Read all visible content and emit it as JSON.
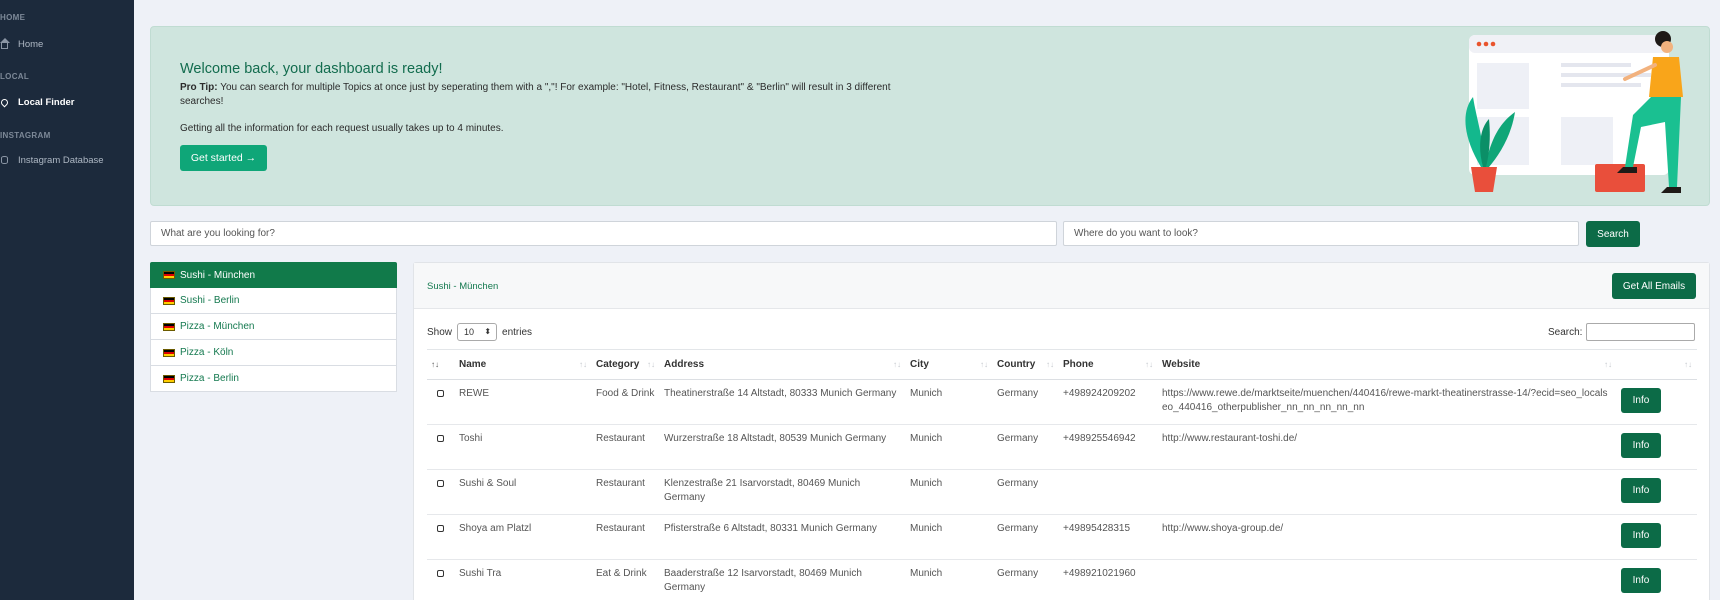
{
  "sidebar": {
    "sections": [
      {
        "heading": "HOME",
        "items": [
          {
            "label": "Home",
            "icon": "home-icon"
          }
        ]
      },
      {
        "heading": "LOCAL",
        "items": [
          {
            "label": "Local Finder",
            "icon": "map-pin-icon"
          }
        ]
      },
      {
        "heading": "INSTAGRAM",
        "items": [
          {
            "label": "Instagram Database",
            "icon": "database-icon"
          }
        ]
      }
    ]
  },
  "banner": {
    "title": "Welcome back, your dashboard is ready!",
    "tip_label": "Pro Tip:",
    "tip_text": " You can search for multiple Topics at once just by seperating them with a \",\"! For example: \"Hotel, Fitness, Restaurant\" & \"Berlin\" will result in 3 different searches!",
    "info": "Getting all the information for each request usually takes up to 4 minutes.",
    "button": "Get started →"
  },
  "search": {
    "what_placeholder": "What are you looking for?",
    "where_placeholder": "Where do you want to look?",
    "button": "Search"
  },
  "saved_searches": [
    {
      "label": "Sushi - München",
      "active": true
    },
    {
      "label": "Sushi - Berlin",
      "active": false
    },
    {
      "label": "Pizza - München",
      "active": false
    },
    {
      "label": "Pizza - Köln",
      "active": false
    },
    {
      "label": "Pizza - Berlin",
      "active": false
    }
  ],
  "results": {
    "title": "Sushi - München",
    "get_emails_button": "Get All Emails",
    "show_label": "Show",
    "entries_value": "10",
    "entries_label": "entries",
    "search_label": "Search:",
    "columns": [
      "",
      "Name",
      "Category",
      "Address",
      "City",
      "Country",
      "Phone",
      "Website",
      ""
    ],
    "rows": [
      {
        "name": "REWE",
        "category": "Food & Drink",
        "address": "Theatinerstraße 14 Altstadt, 80333 Munich Germany",
        "city": "Munich",
        "country": "Germany",
        "phone": "+498924209202",
        "website": "https://www.rewe.de/marktseite/muenchen/440416/rewe-markt-theatinerstrasse-14/?ecid=seo_localseo_440416_otherpublisher_nn_nn_nn_nn_nn",
        "action": "Info"
      },
      {
        "name": "Toshi",
        "category": "Restaurant",
        "address": "Wurzerstraße 18 Altstadt, 80539 Munich Germany",
        "city": "Munich",
        "country": "Germany",
        "phone": "+498925546942",
        "website": "http://www.restaurant-toshi.de/",
        "action": "Info"
      },
      {
        "name": "Sushi & Soul",
        "category": "Restaurant",
        "address": "Klenzestraße 21 Isarvorstadt, 80469 Munich Germany",
        "city": "Munich",
        "country": "Germany",
        "phone": "",
        "website": "",
        "action": "Info"
      },
      {
        "name": "Shoya am Platzl",
        "category": "Restaurant",
        "address": "Pfisterstraße 6 Altstadt, 80331 Munich Germany",
        "city": "Munich",
        "country": "Germany",
        "phone": "+49895428315",
        "website": "http://www.shoya-group.de/",
        "action": "Info"
      },
      {
        "name": "Sushi Tra",
        "category": "Eat & Drink",
        "address": "Baaderstraße 12 Isarvorstadt, 80469 Munich Germany",
        "city": "Munich",
        "country": "Germany",
        "phone": "+498921021960",
        "website": "",
        "action": "Info"
      }
    ]
  },
  "colors": {
    "sidebar_bg": "#1c2a3c",
    "banner_bg": "#cfe5de",
    "primary_green": "#0c6b47",
    "accent_green": "#0fa678"
  }
}
